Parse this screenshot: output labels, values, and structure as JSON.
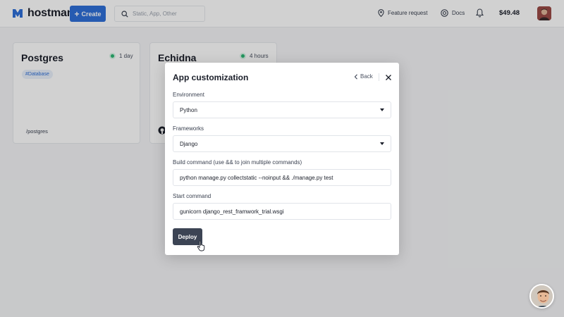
{
  "header": {
    "logo_text": "hostman",
    "create_label": "Create",
    "search_placeholder": "Static, App, Other",
    "feature_request_label": "Feature request",
    "docs_label": "Docs",
    "balance": "$49.48"
  },
  "cards": [
    {
      "title": "Postgres",
      "status": "1 day",
      "tag": "#Database",
      "path": "/postgres"
    },
    {
      "title": "Echidna",
      "status": "4 hours"
    }
  ],
  "modal": {
    "title": "App customization",
    "back_label": "Back",
    "environment_label": "Environment",
    "environment_value": "Python",
    "frameworks_label": "Frameworks",
    "frameworks_value": "Django",
    "build_label": "Build command (use && to join multiple commands)",
    "build_value": "python manage.py collectstatic --noinput && ./manage.py test",
    "start_label": "Start command",
    "start_value": "gunicorn django_rest_framwork_trial.wsgi",
    "deploy_label": "Deploy"
  },
  "colors": {
    "accent": "#2f6fd8",
    "deploy_button": "#3c4454",
    "status_dot": "#2bb673"
  }
}
